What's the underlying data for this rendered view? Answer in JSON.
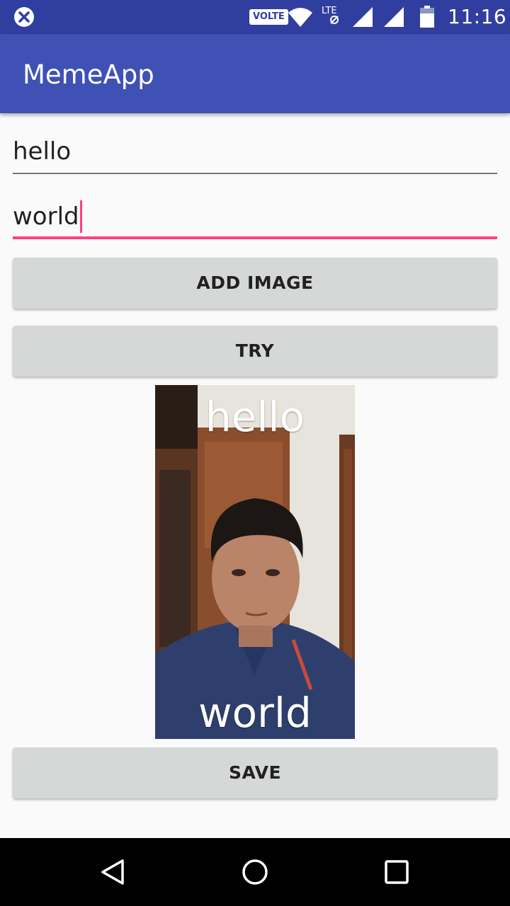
{
  "status_bar": {
    "app_icon": "data-saver-x-icon",
    "network_badge": "VOLTE",
    "lte_label": "LTE",
    "time": "11:16",
    "color": "#303f9f"
  },
  "app_bar": {
    "title": "MemeApp",
    "color": "#3f51b5"
  },
  "form": {
    "top_text": {
      "value": "hello"
    },
    "bottom_text": {
      "value": "world",
      "focused": true,
      "accent_color": "#ff4081"
    }
  },
  "buttons": {
    "add_image": "ADD IMAGE",
    "try": "TRY",
    "save": "SAVE"
  },
  "meme": {
    "top_caption": "hello",
    "bottom_caption": "world"
  },
  "nav_bar": {
    "back": "back-triangle-icon",
    "home": "home-circle-icon",
    "recents": "recents-square-icon"
  }
}
